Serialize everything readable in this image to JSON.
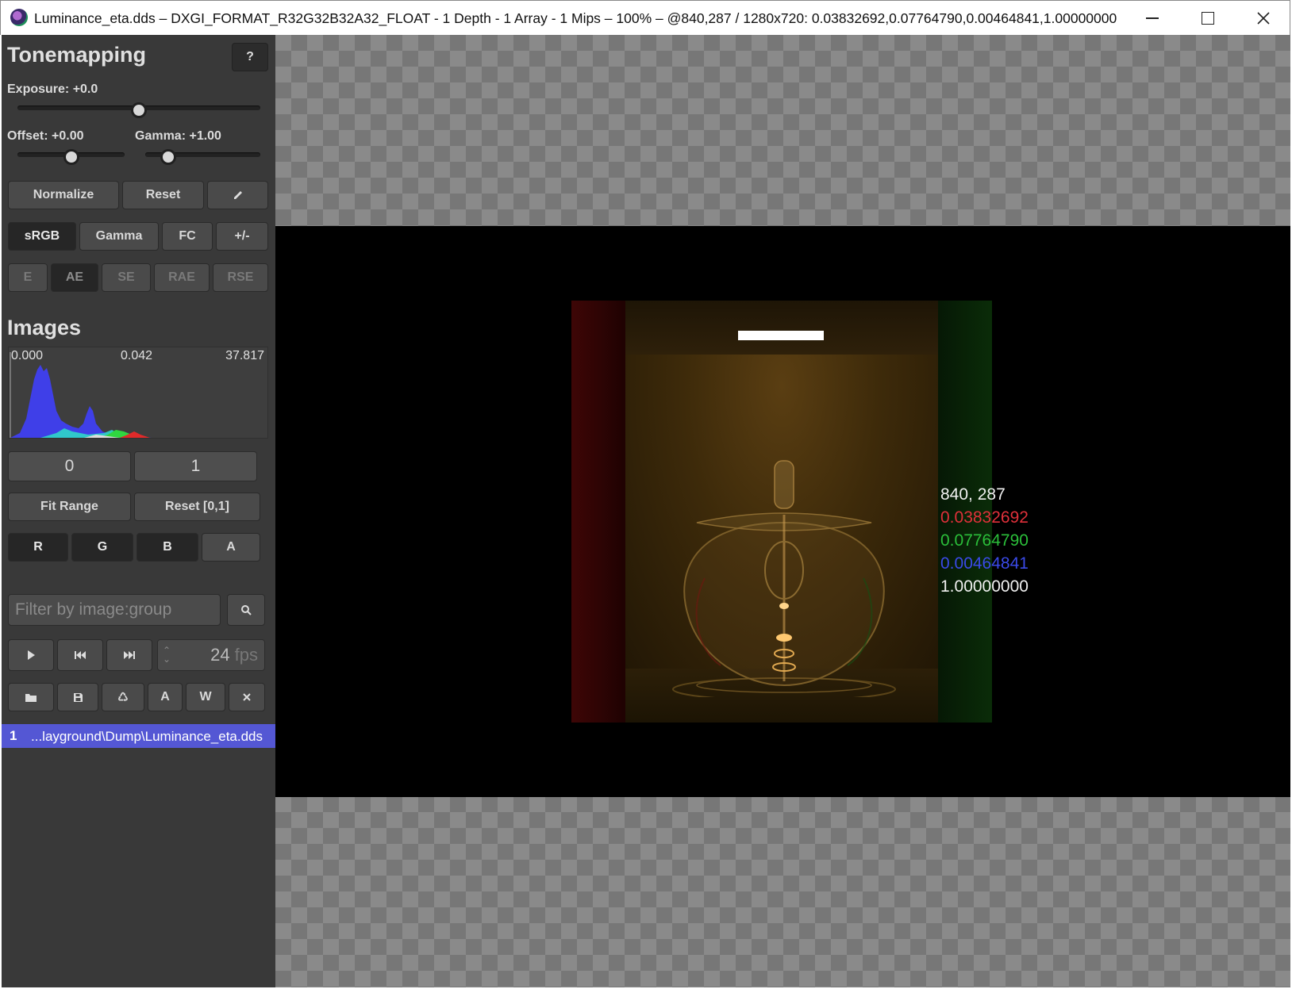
{
  "window": {
    "title": "Luminance_eta.dds –  DXGI_FORMAT_R32G32B32A32_FLOAT - 1 Depth - 1 Array - 1 Mips – 100% – @840,287 / 1280x720: 0.03832692,0.07764790,0.00464841,1.00000000"
  },
  "tonemapping": {
    "title": "Tonemapping",
    "help_label": "?",
    "exposure_label": "Exposure: +0.0",
    "exposure_value": 0.0,
    "offset_label": "Offset: +0.00",
    "offset_value": 0.0,
    "gamma_label": "Gamma: +1.00",
    "gamma_value": 1.0,
    "normalize_label": "Normalize",
    "reset_label": "Reset",
    "modes": [
      "sRGB",
      "Gamma",
      "FC",
      "+/-"
    ],
    "active_mode": "sRGB",
    "metrics": [
      "E",
      "AE",
      "SE",
      "RAE",
      "RSE"
    ],
    "active_metric": "AE"
  },
  "images": {
    "title": "Images",
    "histogram": {
      "min": "0.000",
      "mid": "0.042",
      "max": "37.817"
    },
    "range_min": "0",
    "range_max": "1",
    "fit_range_label": "Fit Range",
    "reset_range_label": "Reset [0,1]",
    "channels": [
      "R",
      "G",
      "B",
      "A"
    ],
    "filter_placeholder": "Filter by image:group",
    "fps_value": "24",
    "fps_unit": "fps",
    "file_actions": [
      "A",
      "W"
    ],
    "list": [
      {
        "index": "1",
        "name": "...layground\\Dump\\Luminance_eta.dds"
      }
    ]
  },
  "pixel_info": {
    "coord": "840, 287",
    "r": "0.03832692",
    "g": "0.07764790",
    "b": "0.00464841",
    "a": "1.00000000"
  },
  "colors": {
    "selection": "#5457d4",
    "panel": "#393939",
    "red_value": "#e0303a",
    "green_value": "#2bbf3a",
    "blue_value": "#3a4ae8"
  }
}
